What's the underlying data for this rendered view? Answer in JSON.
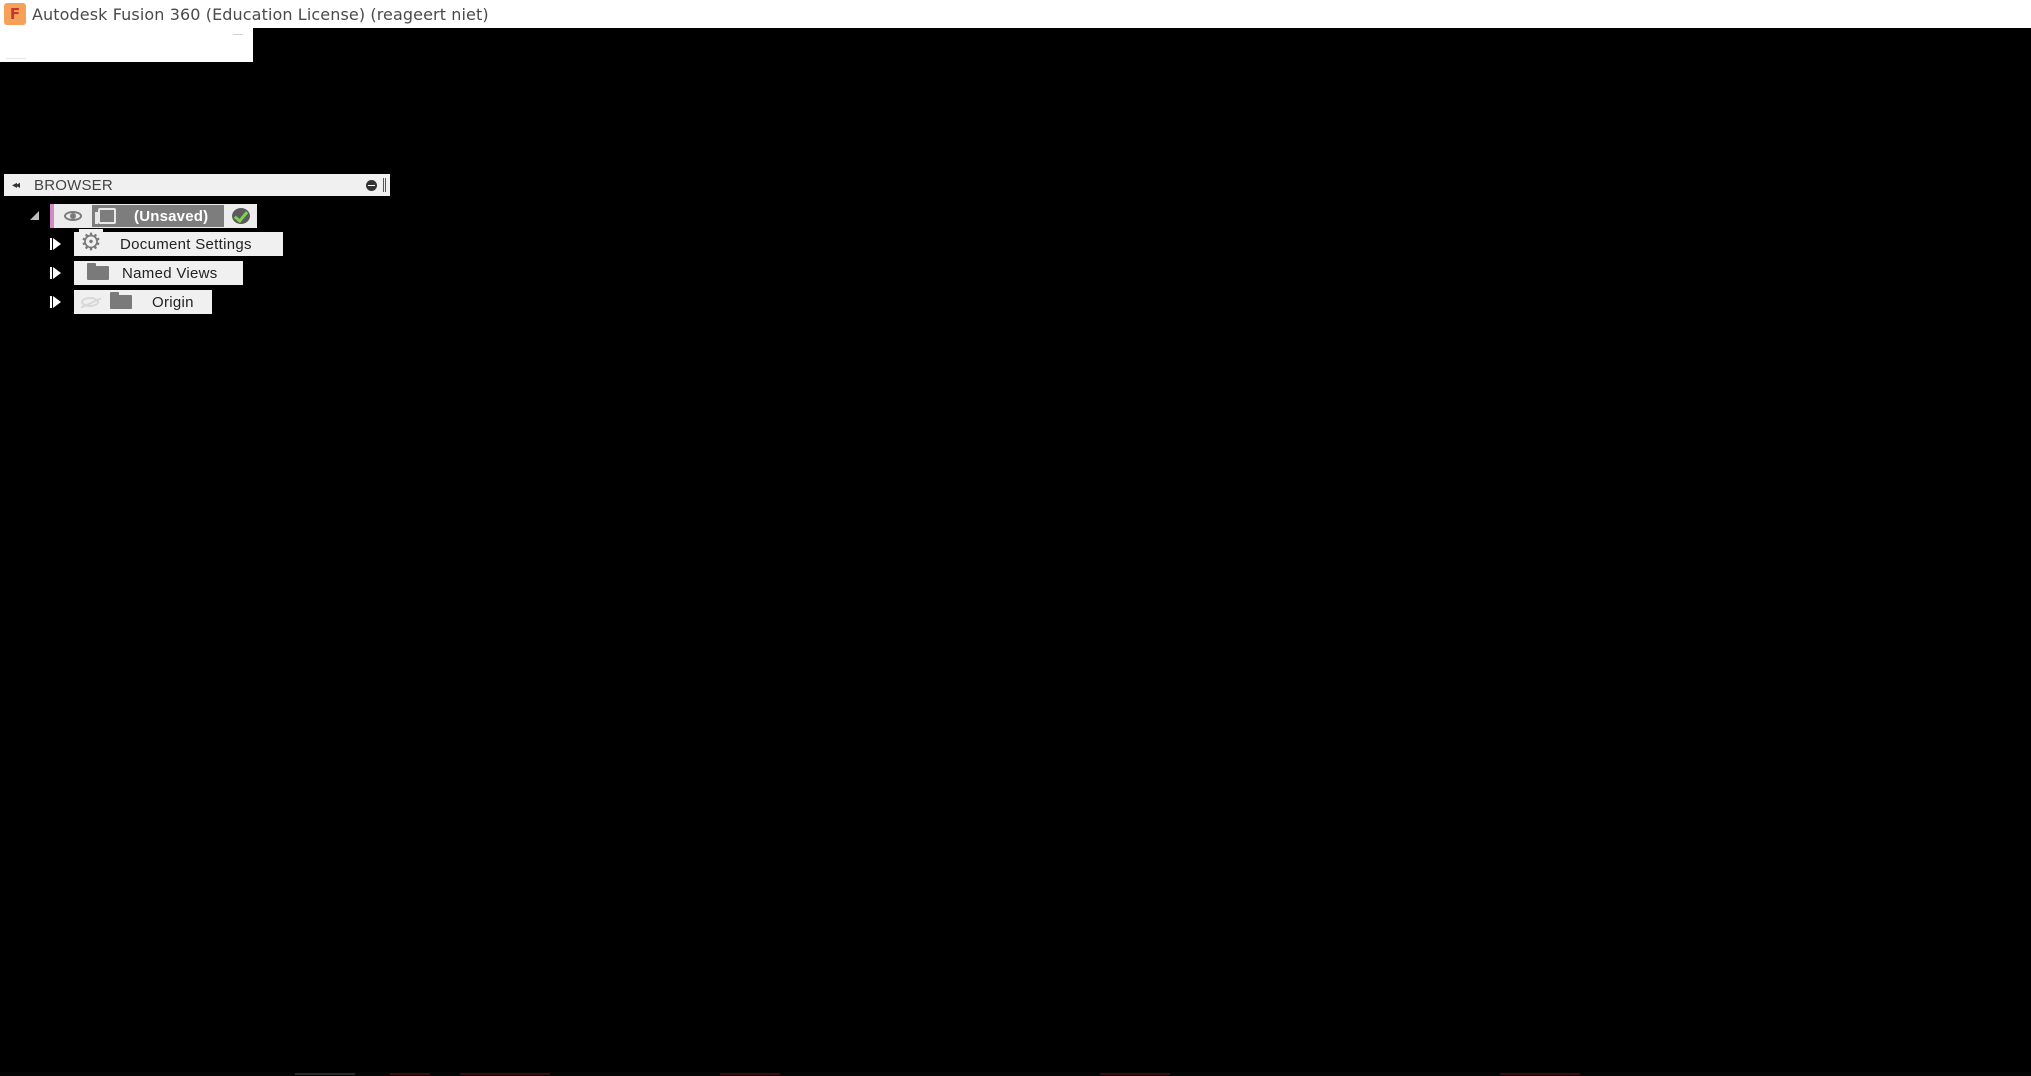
{
  "window": {
    "title": "Autodesk Fusion 360 (Education License) (reageert niet)",
    "app_icon_letter": "F"
  },
  "browser": {
    "title": "BROWSER",
    "root": {
      "label": "(Unsaved)"
    },
    "items": [
      {
        "label": "Document Settings",
        "icon": "gear-icon"
      },
      {
        "label": "Named Views",
        "icon": "folder-icon"
      },
      {
        "label": "Origin",
        "icon": "folder-icon"
      }
    ]
  },
  "colors": {
    "background": "#000000",
    "accent": "#d08bc6",
    "root_highlight": "#7d7d7d",
    "app_icon": "#f6a05a"
  }
}
